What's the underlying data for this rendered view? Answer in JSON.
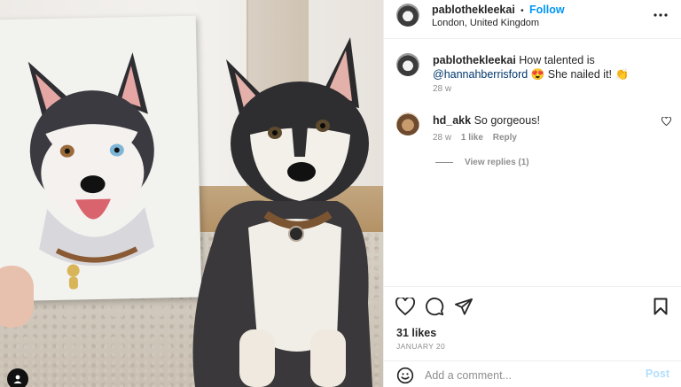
{
  "post": {
    "author": "pablothekleekai",
    "follow_label": "Follow",
    "separator": "•",
    "location": "London, United Kingdom"
  },
  "caption": {
    "username": "pablothekleekai",
    "text_before": "How talented is",
    "mention": "@hannahberrisford",
    "text_after": "She nailed it!",
    "emoji_1": "😍",
    "emoji_2": "👏",
    "age": "28 w"
  },
  "comments": [
    {
      "username": "hd_akk",
      "text": "So gorgeous!",
      "age": "28 w",
      "likes": "1 like",
      "reply_label": "Reply",
      "view_replies": "View replies (1)"
    }
  ],
  "stats": {
    "likes": "31 likes",
    "date": "JANUARY 20"
  },
  "comment_box": {
    "placeholder": "Add a comment...",
    "post_label": "Post"
  },
  "icons": {
    "more": "more-options-icon",
    "heart": "heart-icon",
    "comment": "comment-icon",
    "share": "share-icon",
    "save": "bookmark-icon",
    "emoji": "emoji-icon",
    "small_heart": "small-heart-icon",
    "profile": "profile-icon"
  }
}
